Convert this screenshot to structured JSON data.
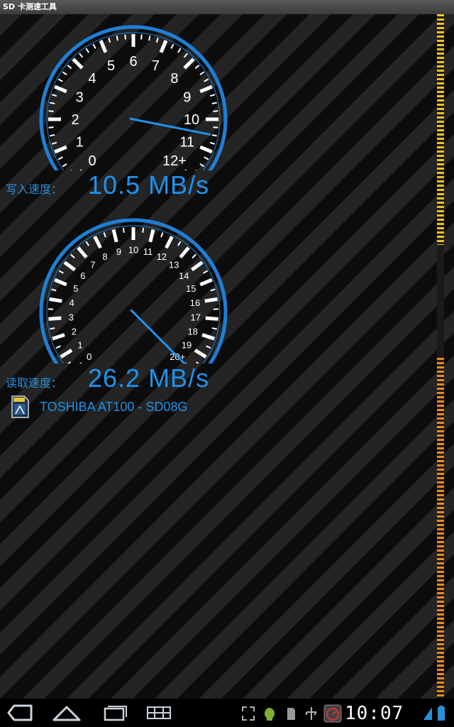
{
  "window": {
    "title": "SD 卡测速工具"
  },
  "write": {
    "label": "写入速度：",
    "value": "10.5 MB/s",
    "speed_mb_s": 10.5,
    "gauge_max": 12,
    "tick_labels": [
      "0",
      "1",
      "2",
      "3",
      "4",
      "5",
      "6",
      "7",
      "8",
      "9",
      "10",
      "11",
      "12+"
    ]
  },
  "read": {
    "label": "读取速度：",
    "value": "26.2 MB/s",
    "speed_mb_s": 26.2,
    "gauge_max": 20,
    "tick_labels": [
      "0",
      "1",
      "2",
      "3",
      "4",
      "5",
      "6",
      "7",
      "8",
      "9",
      "10",
      "11",
      "12",
      "13",
      "14",
      "15",
      "16",
      "17",
      "18",
      "19",
      "20+"
    ]
  },
  "card": {
    "name": "TOSHIBA AT100 - SD08G",
    "icon": "sd-card-icon"
  },
  "statusbar": {
    "time": "10:07"
  },
  "nav": {
    "back_icon": "back-icon",
    "home_icon": "home-icon",
    "recent_icon": "recent-apps-icon",
    "menu_icon": "menu-icon"
  },
  "colors": {
    "accent": "#1e93ee",
    "label": "#2a8fd8",
    "bar_yellow": "#f2c21a",
    "bar_orange": "#f08a1a"
  }
}
